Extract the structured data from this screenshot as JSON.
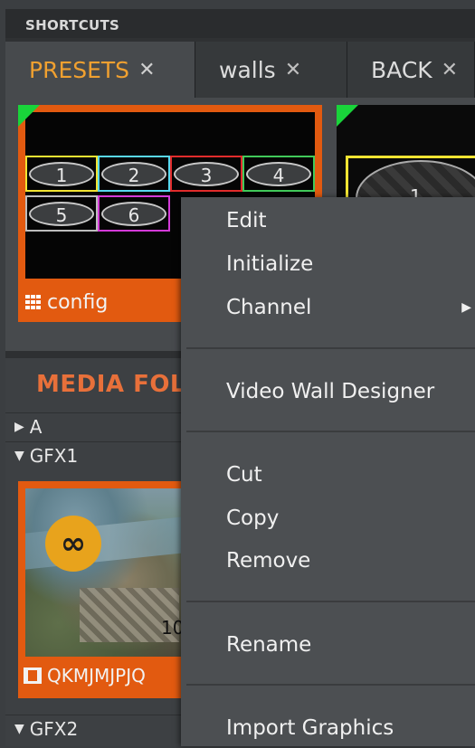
{
  "panel": {
    "title": "SHORTCUTS"
  },
  "tabs": [
    {
      "label": "PRESETS",
      "close": "✕",
      "active": true
    },
    {
      "label": "walls",
      "close": "✕",
      "active": false
    },
    {
      "label": "BACK",
      "close": "✕",
      "active": false
    }
  ],
  "presets": {
    "card1": {
      "name": "config",
      "zones": [
        "1",
        "2",
        "3",
        "4",
        "5",
        "6"
      ],
      "zone_colors": [
        "#f2e432",
        "#58d8f0",
        "#e22c2c",
        "#41c95a",
        "#bdbdbd",
        "#d43ad8"
      ]
    },
    "card2": {
      "zone": "1"
    }
  },
  "media": {
    "title": "MEDIA FOLDERS",
    "folders": [
      {
        "label": "A",
        "expanded": false
      },
      {
        "label": "GFX1",
        "expanded": true
      },
      {
        "label": "GFX2",
        "expanded": true
      }
    ],
    "item": {
      "name": "QKMJMJPJQ",
      "badge": "∞",
      "overlay_text": "10"
    }
  },
  "context_menu": {
    "items": [
      "Edit",
      "Initialize",
      "Channel",
      "Video Wall Designer",
      "Cut",
      "Copy",
      "Remove",
      "Rename",
      "Import Graphics"
    ],
    "submenu_arrow": "▶"
  },
  "colors": {
    "accent": "#f0a030",
    "card": "#e25a10",
    "status_green": "#19d43a"
  }
}
